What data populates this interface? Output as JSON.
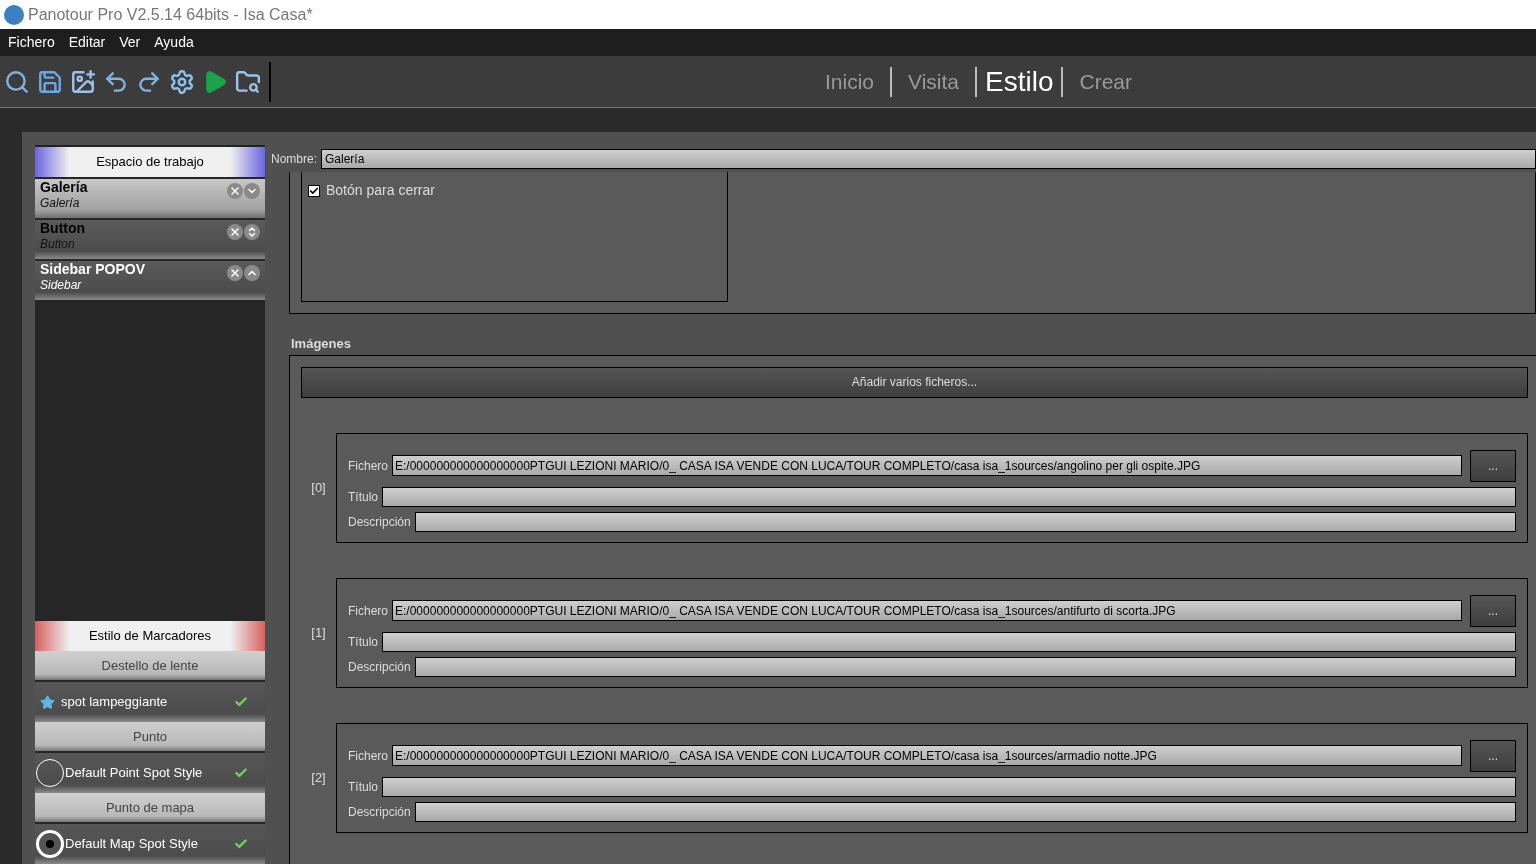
{
  "window": {
    "title": "Panotour Pro V2.5.14 64bits - Isa Casa*"
  },
  "menu": [
    "Fichero",
    "Editar",
    "Ver",
    "Ayuda"
  ],
  "mode_tabs": [
    {
      "label": "Inicio",
      "selected": false
    },
    {
      "label": "Visita",
      "selected": false
    },
    {
      "label": "Estilo",
      "selected": true
    },
    {
      "label": "Crear",
      "selected": false
    }
  ],
  "workspace": {
    "title": "Espacio de trabajo",
    "items": [
      {
        "name": "Galería",
        "type": "Galería",
        "selected": true,
        "kind": "down"
      },
      {
        "name": "Button",
        "type": "Button",
        "selected": false,
        "kind": "updown"
      },
      {
        "name": "Sidebar POPOV",
        "type": "Sidebar",
        "selected": false,
        "kind": "up"
      }
    ]
  },
  "marker_styles": {
    "title": "Estilo de Marcadores",
    "groups": [
      {
        "label": "Destello de lente",
        "item": {
          "name": "spot lampeggiante",
          "kind": "star",
          "checked": true
        }
      },
      {
        "label": "Punto",
        "item": {
          "name": "Default Point Spot Style",
          "kind": "ring",
          "checked": true
        }
      },
      {
        "label": "Punto de mapa",
        "item": {
          "name": "Default Map Spot Style",
          "kind": "target",
          "checked": true
        }
      }
    ]
  },
  "name_field": {
    "label": "Nombre:",
    "value": "Galería"
  },
  "options": [
    {
      "label": "Botón para cerrar",
      "checked": true
    }
  ],
  "images": {
    "title": "Imágenes",
    "add_button": "Añadir varios ficheros...",
    "entries": [
      {
        "index": "[0]",
        "file_label": "Fichero",
        "title_label": "Título",
        "description_label": "Descripción",
        "browse": "...",
        "file": "E:/000000000000000000PTGUI LEZIONI MARIO/0_ CASA ISA VENDE CON LUCA/TOUR COMPLETO/casa isa_1sources/angolino per gli ospite.JPG"
      },
      {
        "index": "[1]",
        "file_label": "Fichero",
        "title_label": "Título",
        "description_label": "Descripción",
        "browse": "...",
        "file": "E:/000000000000000000PTGUI LEZIONI MARIO/0_ CASA ISA VENDE CON LUCA/TOUR COMPLETO/casa isa_1sources/antifurto di scorta.JPG"
      },
      {
        "index": "[2]",
        "file_label": "Fichero",
        "title_label": "Título",
        "description_label": "Descripción",
        "browse": "...",
        "file": "E:/000000000000000000PTGUI LEZIONI MARIO/0_ CASA ISA VENDE CON LUCA/TOUR COMPLETO/casa isa_1sources/armadio notte.JPG"
      }
    ]
  }
}
